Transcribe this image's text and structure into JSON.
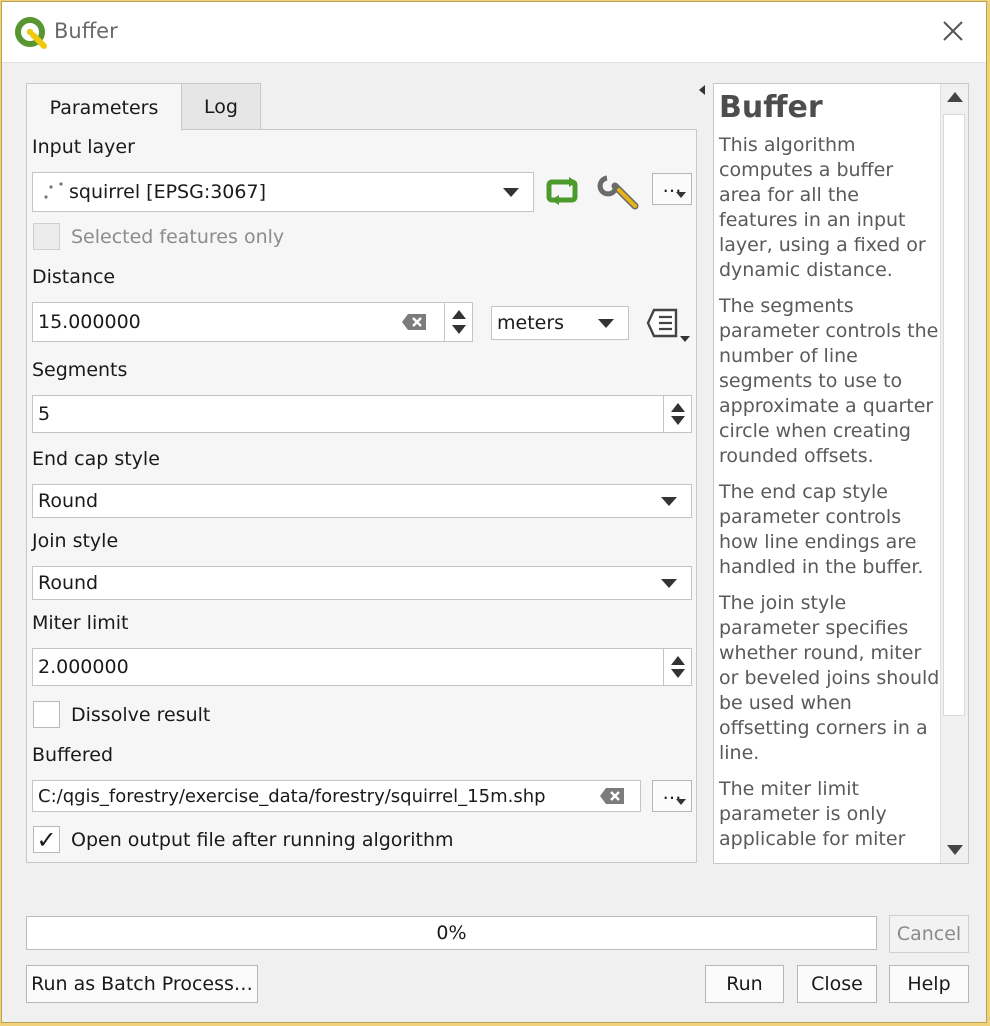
{
  "window": {
    "title": "Buffer"
  },
  "tabs": [
    {
      "label": "Parameters",
      "active": true
    },
    {
      "label": "Log",
      "active": false
    }
  ],
  "params": {
    "input_layer": {
      "label": "Input layer",
      "value": "squirrel [EPSG:3067]",
      "more": "…"
    },
    "selected_only": {
      "label": "Selected features only",
      "checked": false
    },
    "distance": {
      "label": "Distance",
      "value": "15.000000",
      "unit": "meters"
    },
    "segments": {
      "label": "Segments",
      "value": "5"
    },
    "end_cap": {
      "label": "End cap style",
      "value": "Round"
    },
    "join_style": {
      "label": "Join style",
      "value": "Round"
    },
    "miter": {
      "label": "Miter limit",
      "value": "2.000000"
    },
    "dissolve": {
      "label": "Dissolve result",
      "checked": false
    },
    "output": {
      "label": "Buffered",
      "value": "C:/qgis_forestry/exercise_data/forestry/squirrel_15m.shp",
      "more": "…"
    },
    "open_output": {
      "label": "Open output file after running algorithm",
      "checked": true,
      "mark": "✓"
    }
  },
  "help": {
    "title": "Buffer",
    "paragraphs": [
      "This algorithm computes a buffer area for all the features in an input layer, using a fixed or dynamic distance.",
      "The segments parameter controls the number of line segments to use to approximate a quarter circle when creating rounded offsets.",
      "The end cap style parameter controls how line endings are handled in the buffer.",
      "The join style parameter specifies whether round, miter or beveled joins should be used when offsetting corners in a line.",
      "The miter limit parameter is only applicable for miter"
    ]
  },
  "progress": {
    "percent": 0,
    "label": "0%"
  },
  "buttons": {
    "cancel": "Cancel",
    "batch": "Run as Batch Process…",
    "run": "Run",
    "close": "Close",
    "help": "Help"
  },
  "colors": {
    "accent": "#4a9be0",
    "qgis_green": "#589632",
    "qgis_yellow": "#eec90d"
  }
}
